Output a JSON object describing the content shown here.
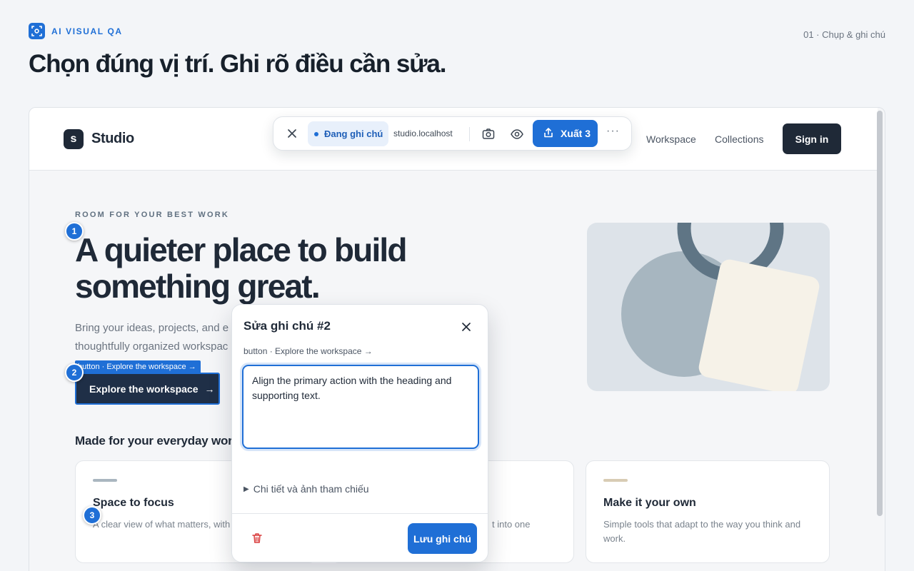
{
  "header": {
    "brand": "AI VISUAL QA",
    "step": "01 · Chụp & ghi chú",
    "title": "Chọn đúng vị trí. Ghi rõ điều cần sửa."
  },
  "site": {
    "logo_mark": "s",
    "logo_text": "Studio",
    "nav": [
      "Workspace",
      "Collections"
    ],
    "signin": "Sign in",
    "eyebrow": "ROOM FOR YOUR BEST WORK",
    "hero_title_line1": "A quieter place to build",
    "hero_title_line2": "something great.",
    "hero_sub_line1": "Bring your ideas, projects, and e",
    "hero_sub_line2": "thoughtfully organized workspac",
    "cta": "Explore the workspace",
    "cta_arrow": "→",
    "section_title": "Made for your everyday work",
    "cards": [
      {
        "title": "Space to focus",
        "text": "A clear view of what matters, with next idea.",
        "bar_color": "#aab6c0"
      },
      {
        "title": "",
        "text": "t into one",
        "bar_color": "#aab6c0"
      },
      {
        "title": "Make it your own",
        "text": "Simple tools that adapt to the way you think and work.",
        "bar_color": "#d8ccb4"
      }
    ]
  },
  "markers": {
    "m1": "1",
    "m2": "2",
    "m3": "3",
    "tag": "button · Explore the workspace →"
  },
  "toolbar": {
    "status": "Đang ghi chú",
    "url": "studio.localhost",
    "export": "Xuất 3",
    "more": "···",
    "icons": [
      "close-icon",
      "camera-icon",
      "eye-icon",
      "share-icon"
    ]
  },
  "popup": {
    "title": "Sửa ghi chú #2",
    "target": "button · Explore the workspace →",
    "note": "Align the primary action with the heading and supporting text.",
    "details": "Chi tiết và ảnh tham chiếu",
    "save": "Lưu ghi chú"
  },
  "colors": {
    "accent": "#1f6fd6",
    "dark": "#1f2937",
    "danger": "#d93b3b"
  }
}
